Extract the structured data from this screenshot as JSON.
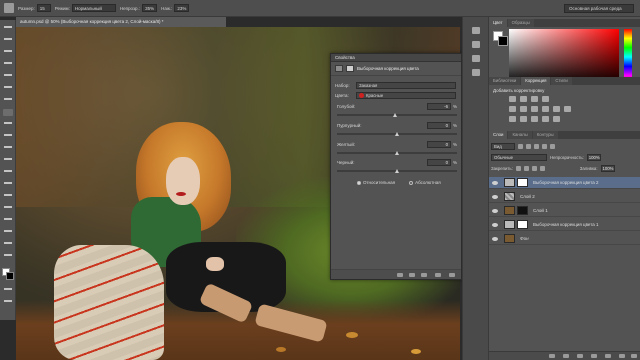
{
  "optbar": {
    "size_label": "Размер:",
    "size_value": "15",
    "mode_label": "Режим:",
    "mode_value": "Нормальный",
    "opacity_label": "Непрозр.:",
    "opacity_value": "35%",
    "press_label": "Наж.:",
    "press_value": "23%",
    "workspace": "Основная рабочая среда"
  },
  "document": {
    "tab_title": "autumn.psd @ 50% (Выборочная коррекция цвета 2, Слой-маска/8) *"
  },
  "properties": {
    "panel_title": "Свойства",
    "header": "Выборочная коррекция цвета",
    "preset_label": "Набор:",
    "preset_value": "Заказная",
    "colors_label": "Цвета:",
    "colors_value": "Красные",
    "sliders": [
      {
        "label": "Голубой:",
        "value": "-6",
        "unit": "%"
      },
      {
        "label": "Пурпурный:",
        "value": "0",
        "unit": "%"
      },
      {
        "label": "Желтый:",
        "value": "0",
        "unit": "%"
      },
      {
        "label": "Черный:",
        "value": "0",
        "unit": "%"
      }
    ],
    "method_relative": "Относительная",
    "method_absolute": "Абсолютная"
  },
  "color_panel": {
    "tab_color": "Цвет",
    "tab_swatches": "Образцы"
  },
  "adjust_panel": {
    "tab_library": "Библиотеки",
    "tab_correction": "Коррекция",
    "tab_styles": "Стили",
    "title": "Добавить корректировку"
  },
  "layers_panel": {
    "tab_layers": "Слои",
    "tab_channels": "Каналы",
    "tab_paths": "Контуры",
    "kind_value": "Вид",
    "blend_value": "Обычные",
    "opacity_label": "Непрозрачность:",
    "opacity_value": "100%",
    "lock_label": "Закрепить:",
    "fill_label": "Заливка:",
    "fill_value": "100%",
    "layers": [
      {
        "name": "Выборочная коррекция цвета 2",
        "selected": true
      },
      {
        "name": "Слой 2",
        "selected": false
      },
      {
        "name": "Слой 1",
        "selected": false
      },
      {
        "name": "Выборочная коррекция цвета 1",
        "selected": false
      },
      {
        "name": "Фон",
        "selected": false
      }
    ]
  },
  "colors": {
    "accent_selected": "#5a6e8c",
    "red_swatch": "#d02020"
  }
}
